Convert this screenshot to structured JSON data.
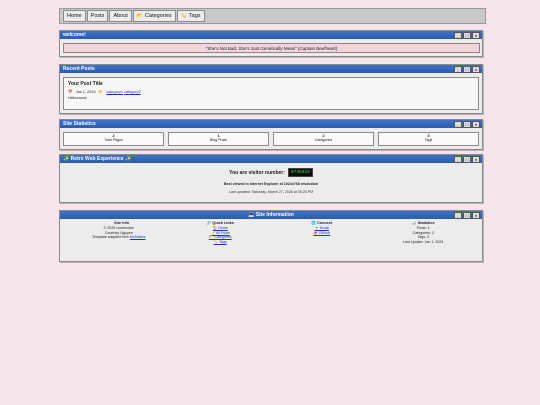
{
  "nav": [
    {
      "label": "Home",
      "icon": ""
    },
    {
      "label": "Posts",
      "icon": ""
    },
    {
      "label": "About",
      "icon": ""
    },
    {
      "label": "Categories",
      "icon": "📂"
    },
    {
      "label": "Tags",
      "icon": "🏷️"
    }
  ],
  "welcome": {
    "title": "welcome!",
    "quote": "\"She's Not Bad, She's Just Genetically Mean\" (Captain Beefheart)"
  },
  "recent_posts": {
    "title": "Recent Posts",
    "post_title": "Your Post Title",
    "date": "Jan 1, 2024",
    "categories": [
      "category1",
      "category2"
    ],
    "excerpt": "Helloooooo!"
  },
  "site_stats": {
    "title": "Site Statistics",
    "items": [
      {
        "value": "2",
        "label": "Total Pages"
      },
      {
        "value": "1",
        "label": "Blog Posts"
      },
      {
        "value": "2",
        "label": "Categories"
      },
      {
        "value": "3",
        "label": "Tags"
      }
    ]
  },
  "retro": {
    "title": "✨ Retro Web Experience ✨",
    "visitor_label": "You are visitor number:",
    "visitor_count": "0738529",
    "best_viewed": "Best viewed in Internet Explorer at 1024x768 resolution",
    "last_updated": "Last updated: Saturday, March 27, 2026 at 05:25 PM"
  },
  "site_info": {
    "title": "💻 Site Information",
    "columns": [
      {
        "head": "📄 Site Info",
        "lines": [
          "© 2025 courtroolee",
          "Courtney Nguyen",
          "Template adapted from "
        ],
        "link": "MoMakes"
      },
      {
        "head": "🔗 Quick Links",
        "links": [
          "🏠 Home",
          "📝 All Posts",
          "📂 Categories",
          "🏷️ Tags"
        ]
      },
      {
        "head": "🌐 Connect",
        "links": [
          "📧 Email",
          "🐙 GitHub"
        ]
      },
      {
        "head": "📊 Statistics",
        "lines": [
          "Posts: 1",
          "Categories: 2",
          "Tags: 3",
          "Last Update: Jan 1, 2024"
        ]
      }
    ]
  },
  "window_buttons": [
    "_",
    "□",
    "×"
  ],
  "colors": {
    "background": "#f5e4e9",
    "titlebar": "#2f63b8",
    "counter_text": "#37e14a"
  }
}
